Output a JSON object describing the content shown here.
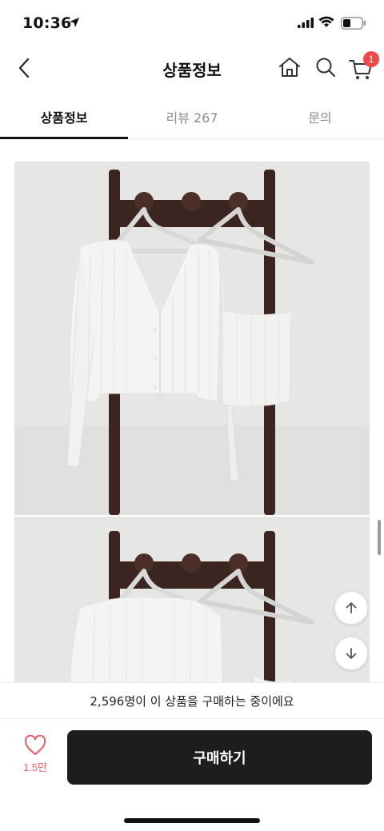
{
  "status_bar": {
    "time": "10:36"
  },
  "header": {
    "title": "상품정보",
    "cart_count": "1"
  },
  "tabs": [
    {
      "label": "상품정보",
      "active": true
    },
    {
      "label": "리뷰 267",
      "active": false
    },
    {
      "label": "문의",
      "active": false
    }
  ],
  "notice": {
    "text": "2,596명이 이 상품을 구매하는 중이에요"
  },
  "bottom_bar": {
    "like_count": "1.5만",
    "buy_label": "구매하기"
  },
  "colors": {
    "accent": "#f24747",
    "like": "#ee5a6a",
    "buy_button": "#1d1d1d"
  },
  "icons": [
    "location-arrow-icon",
    "signal-icon",
    "wifi-icon",
    "battery-icon",
    "back-chevron-icon",
    "home-icon",
    "search-icon",
    "cart-icon",
    "arrow-up-icon",
    "arrow-down-icon",
    "heart-icon"
  ]
}
